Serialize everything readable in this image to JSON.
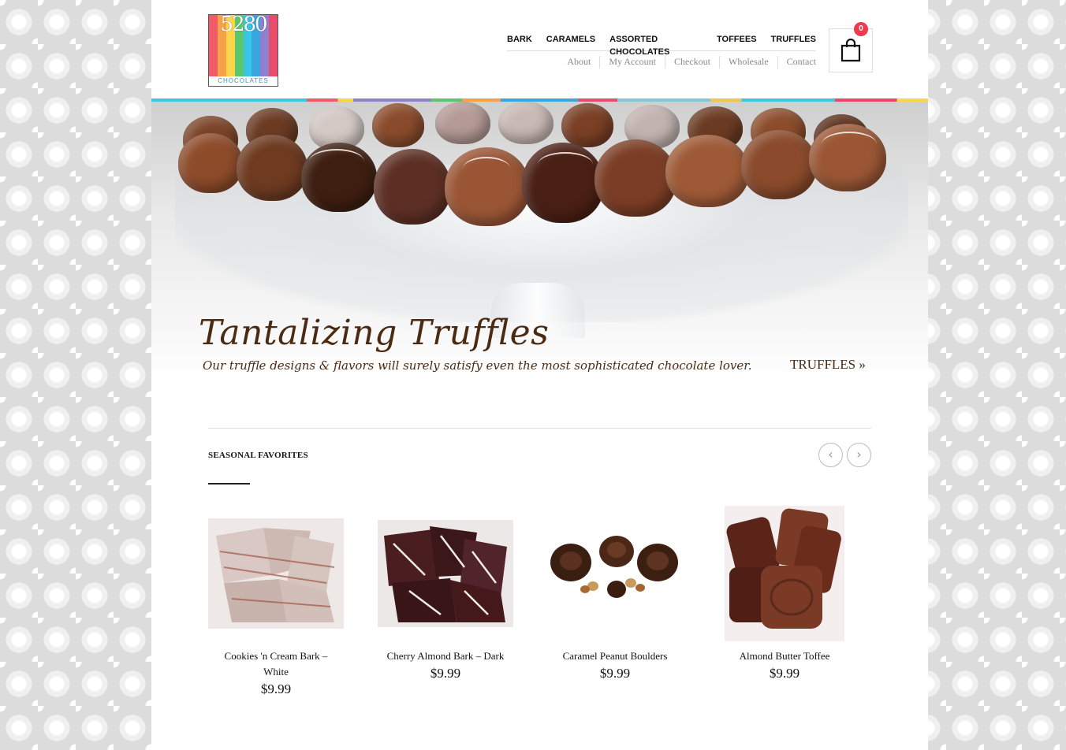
{
  "logo": {
    "digits": "5280",
    "tagline": "CHOCOLATES"
  },
  "main_nav": [
    "BARK",
    "CARAMELS",
    "ASSORTED CHOCOLATES",
    "TOFFEES",
    "TRUFFLES"
  ],
  "sub_nav": [
    "About",
    "My Account",
    "Checkout",
    "Wholesale",
    "Contact"
  ],
  "cart": {
    "count": "0",
    "icon": "shopping-bag-icon"
  },
  "hero": {
    "title": "Tantalizing Truffles",
    "subtitle": "Our truffle designs & flavors will surely satisfy even the most sophisticated chocolate lover.",
    "link": "TRUFFLES »"
  },
  "section": {
    "title": "SEASONAL FAVORITES",
    "prev_icon": "chevron-left-icon",
    "next_icon": "chevron-right-icon"
  },
  "products": [
    {
      "name": "Cookies 'n Cream Bark – White",
      "price": "$9.99"
    },
    {
      "name": "Cherry Almond Bark – Dark",
      "price": "$9.99"
    },
    {
      "name": "Caramel Peanut Boulders",
      "price": "$9.99"
    },
    {
      "name": "Almond Butter Toffee",
      "price": "$9.99"
    }
  ],
  "colors": {
    "cart_badge": "#ee3a4f",
    "chocolate_text": "#4a2a12",
    "accent_rainbow": [
      "#39c6e6",
      "#f25a6a",
      "#ffd54a",
      "#8f7fcf",
      "#5bc66c",
      "#f5a14a"
    ]
  }
}
